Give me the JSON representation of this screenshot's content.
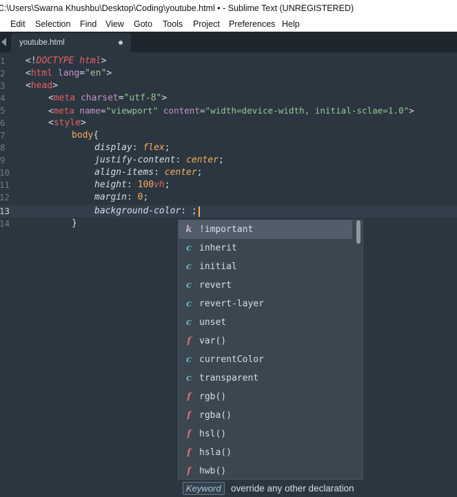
{
  "window": {
    "title": "C:\\Users\\Swarna Khushbu\\Desktop\\Coding\\youtube.html • - Sublime Text (UNREGISTERED)"
  },
  "menu": [
    "Edit",
    "Selection",
    "Find",
    "View",
    "Goto",
    "Tools",
    "Project",
    "Preferences",
    "Help"
  ],
  "tab": {
    "label": "youtube.html",
    "dirty_icon": "circle-dot-icon"
  },
  "gutter": [
    "1",
    "2",
    "3",
    "4",
    "5",
    "6",
    "7",
    "8",
    "9",
    "10",
    "11",
    "12",
    "13",
    "14"
  ],
  "code": {
    "l1": {
      "a": "<!",
      "b": "DOCTYPE html",
      "c": ">"
    },
    "l2": {
      "a": "<",
      "b": "html",
      "c": " lang",
      "d": "=",
      "e": "\"en\"",
      "f": ">"
    },
    "l3": {
      "a": "<",
      "b": "head",
      "c": ">"
    },
    "l4": {
      "a": "<",
      "b": "meta",
      "c": " charset",
      "d": "=",
      "e": "\"utf-8\"",
      "f": ">"
    },
    "l5": {
      "a": "<",
      "b": "meta",
      "c": " name",
      "d": "=",
      "e": "\"viewport\"",
      "f": " content",
      "g": "=",
      "h": "\"width=device-width, initial-sclae=1.0\"",
      "i": ">"
    },
    "l6": {
      "a": "<",
      "b": "style",
      "c": ">"
    },
    "l7": {
      "a": "body",
      "b": "{"
    },
    "l8": {
      "a": "display",
      "b": ": ",
      "c": "flex",
      "d": ";"
    },
    "l9": {
      "a": "justify-content",
      "b": ": ",
      "c": "center",
      "d": ";"
    },
    "l10": {
      "a": "align-items",
      "b": ": ",
      "c": "center",
      "d": ";"
    },
    "l11": {
      "a": "height",
      "b": ": ",
      "c": "100",
      "d": "vh",
      "e": ";"
    },
    "l12": {
      "a": "margin",
      "b": ": ",
      "c": "0",
      "d": ";"
    },
    "l13": {
      "a": "background-color",
      "b": ": ",
      "c": ";"
    },
    "l14": {
      "a": "}"
    }
  },
  "autocomplete": {
    "items": [
      {
        "kind": "k",
        "label": "!important",
        "selected": true
      },
      {
        "kind": "c",
        "label": "inherit"
      },
      {
        "kind": "c",
        "label": "initial"
      },
      {
        "kind": "c",
        "label": "revert"
      },
      {
        "kind": "c",
        "label": "revert-layer"
      },
      {
        "kind": "c",
        "label": "unset"
      },
      {
        "kind": "f",
        "label": "var()"
      },
      {
        "kind": "c",
        "label": "currentColor"
      },
      {
        "kind": "c",
        "label": "transparent"
      },
      {
        "kind": "f",
        "label": "rgb()"
      },
      {
        "kind": "f",
        "label": "rgba()"
      },
      {
        "kind": "f",
        "label": "hsl()"
      },
      {
        "kind": "f",
        "label": "hsla()"
      },
      {
        "kind": "f",
        "label": "hwb()"
      }
    ],
    "footer": {
      "kind_label": "Keyword",
      "description": "override any other declaration"
    }
  }
}
